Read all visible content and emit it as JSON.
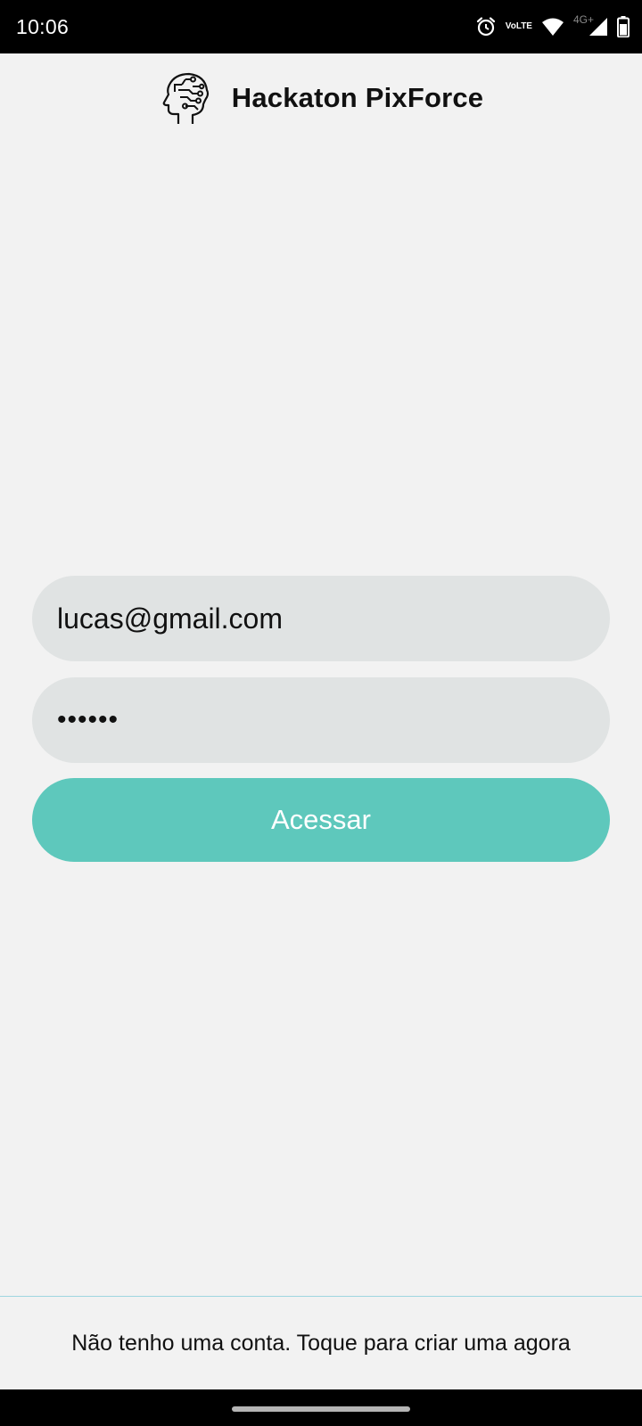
{
  "status_bar": {
    "time": "10:06",
    "volte_top": "Vo",
    "volte_bottom": "LTE",
    "network_type": "4G+",
    "icons": [
      "alarm-icon",
      "volte-icon",
      "wifi-icon",
      "signal-icon",
      "battery-icon"
    ]
  },
  "header": {
    "logo_icon": "brain-circuit-head-icon",
    "title": "Hackaton PixForce"
  },
  "form": {
    "email_value": "lucas@gmail.com",
    "password_value": "••••••",
    "submit_label": "Acessar"
  },
  "footer": {
    "signup_text": "Não tenho uma conta. Toque para criar uma agora"
  },
  "colors": {
    "background": "#f2f2f2",
    "field_bg": "#e0e3e3",
    "accent": "#5ec8bc",
    "footer_divider": "#9fd6e0"
  }
}
